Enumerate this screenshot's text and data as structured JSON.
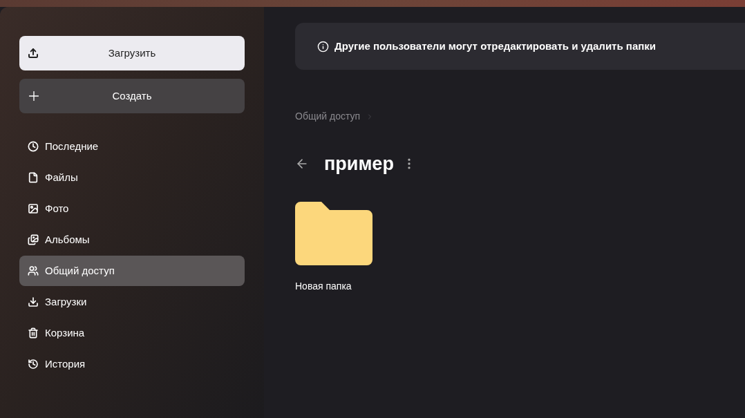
{
  "sidebar": {
    "upload_button": {
      "label": "Загрузить"
    },
    "create_button": {
      "label": "Создать"
    },
    "items": [
      {
        "kind": "recent",
        "label": "Последние",
        "selected": false
      },
      {
        "kind": "files",
        "label": "Файлы",
        "selected": false
      },
      {
        "kind": "photo",
        "label": "Фото",
        "selected": false
      },
      {
        "kind": "albums",
        "label": "Альбомы",
        "selected": false
      },
      {
        "kind": "shared",
        "label": "Общий доступ",
        "selected": true
      },
      {
        "kind": "downloads",
        "label": "Загрузки",
        "selected": false
      },
      {
        "kind": "trash",
        "label": "Корзина",
        "selected": false
      },
      {
        "kind": "history",
        "label": "История",
        "selected": false
      }
    ]
  },
  "banner": {
    "text": "Другие пользователи могут отредактировать и удалить папки"
  },
  "breadcrumbs": [
    "Общий доступ"
  ],
  "folder_title": "пример",
  "items": [
    {
      "kind": "folder",
      "name": "Новая папка"
    }
  ]
}
